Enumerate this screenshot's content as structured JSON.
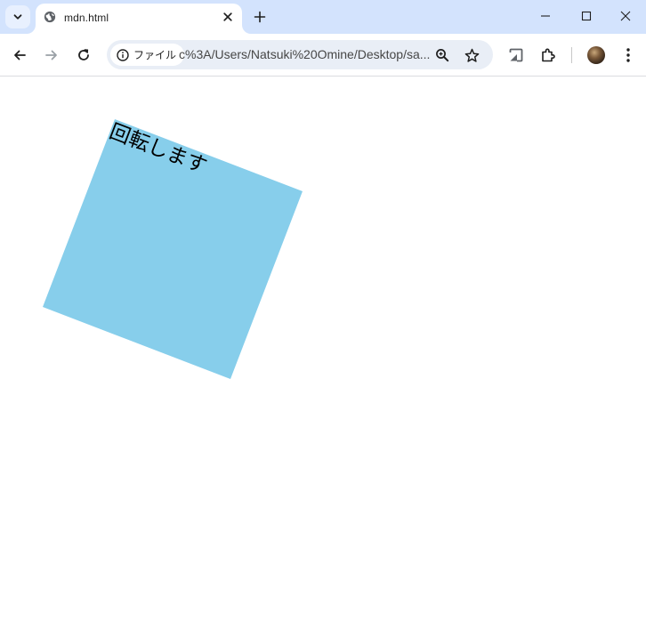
{
  "browser": {
    "tab": {
      "title": "mdn.html",
      "favicon": "globe-icon"
    },
    "address_bar": {
      "site_chip_label": "ファイル",
      "url": "c%3A/Users/Natsuki%20Omine/Desktop/sa..."
    },
    "toolbar_icons": [
      "back-icon",
      "forward-icon",
      "reload-icon",
      "zoom-icon",
      "star-icon",
      "cast-icon",
      "extensions-icon",
      "avatar",
      "menu-icon"
    ],
    "window_controls": [
      "minimize-icon",
      "maximize-icon",
      "close-icon"
    ]
  },
  "page": {
    "box_text": "回転します",
    "box_color": "#87ceeb",
    "rotation_deg": 21
  }
}
